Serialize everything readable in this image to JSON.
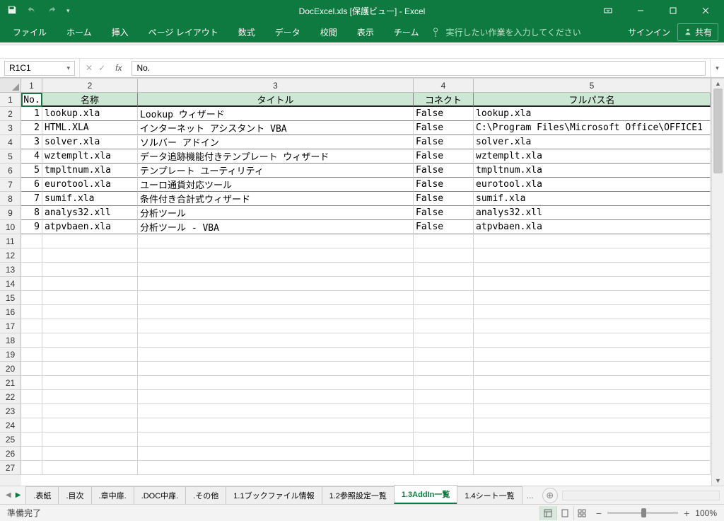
{
  "title": "DocExcel.xls  [保護ビュー] - Excel",
  "ribbon": {
    "tabs": [
      "ファイル",
      "ホーム",
      "挿入",
      "ページ レイアウト",
      "数式",
      "データ",
      "校閲",
      "表示",
      "チーム"
    ],
    "tellme": "実行したい作業を入力してください",
    "signin": "サインイン",
    "share": "共有"
  },
  "namebox": "R1C1",
  "formula": "No.",
  "col_headers": [
    "1",
    "2",
    "3",
    "4",
    "5"
  ],
  "row_headers": [
    "1",
    "2",
    "3",
    "4",
    "5",
    "6",
    "7",
    "8",
    "9",
    "10",
    "11",
    "12",
    "13",
    "14",
    "15",
    "16",
    "17",
    "18",
    "19",
    "20",
    "21",
    "22",
    "23",
    "24",
    "25",
    "26",
    "27"
  ],
  "headers": [
    "No.",
    "名称",
    "タイトル",
    "コネクト",
    "フルパス名"
  ],
  "rows": [
    {
      "no": "1",
      "name": "lookup.xla",
      "title": "Lookup ウィザード",
      "connect": "False",
      "path": "lookup.xla"
    },
    {
      "no": "2",
      "name": "HTML.XLA",
      "title": "インターネット アシスタント VBA",
      "connect": "False",
      "path": "C:\\Program Files\\Microsoft Office\\OFFICE1"
    },
    {
      "no": "3",
      "name": "solver.xla",
      "title": "ソルバー アドイン",
      "connect": "False",
      "path": "solver.xla"
    },
    {
      "no": "4",
      "name": "wztemplt.xla",
      "title": "データ追跡機能付きテンプレート ウィザード",
      "connect": "False",
      "path": "wztemplt.xla"
    },
    {
      "no": "5",
      "name": "tmpltnum.xla",
      "title": "テンプレート ユーティリティ",
      "connect": "False",
      "path": "tmpltnum.xla"
    },
    {
      "no": "6",
      "name": "eurotool.xla",
      "title": "ユーロ通貨対応ツール",
      "connect": "False",
      "path": "eurotool.xla"
    },
    {
      "no": "7",
      "name": "sumif.xla",
      "title": "条件付き合計式ウィザード",
      "connect": "False",
      "path": "sumif.xla"
    },
    {
      "no": "8",
      "name": "analys32.xll",
      "title": "分析ツール",
      "connect": "False",
      "path": "analys32.xll"
    },
    {
      "no": "9",
      "name": "atpvbaen.xla",
      "title": "分析ツール - VBA",
      "connect": "False",
      "path": "atpvbaen.xla"
    }
  ],
  "sheets": [
    ".表紙",
    ".目次",
    ".章中扉.",
    ".DOC中扉.",
    ".その他",
    "1.1ブックファイル情報",
    "1.2参照設定一覧",
    "1.3AddIn一覧",
    "1.4シート一覧"
  ],
  "active_sheet": "1.3AddIn一覧",
  "more_sheets": "...",
  "status": "準備完了",
  "zoom": "100%"
}
